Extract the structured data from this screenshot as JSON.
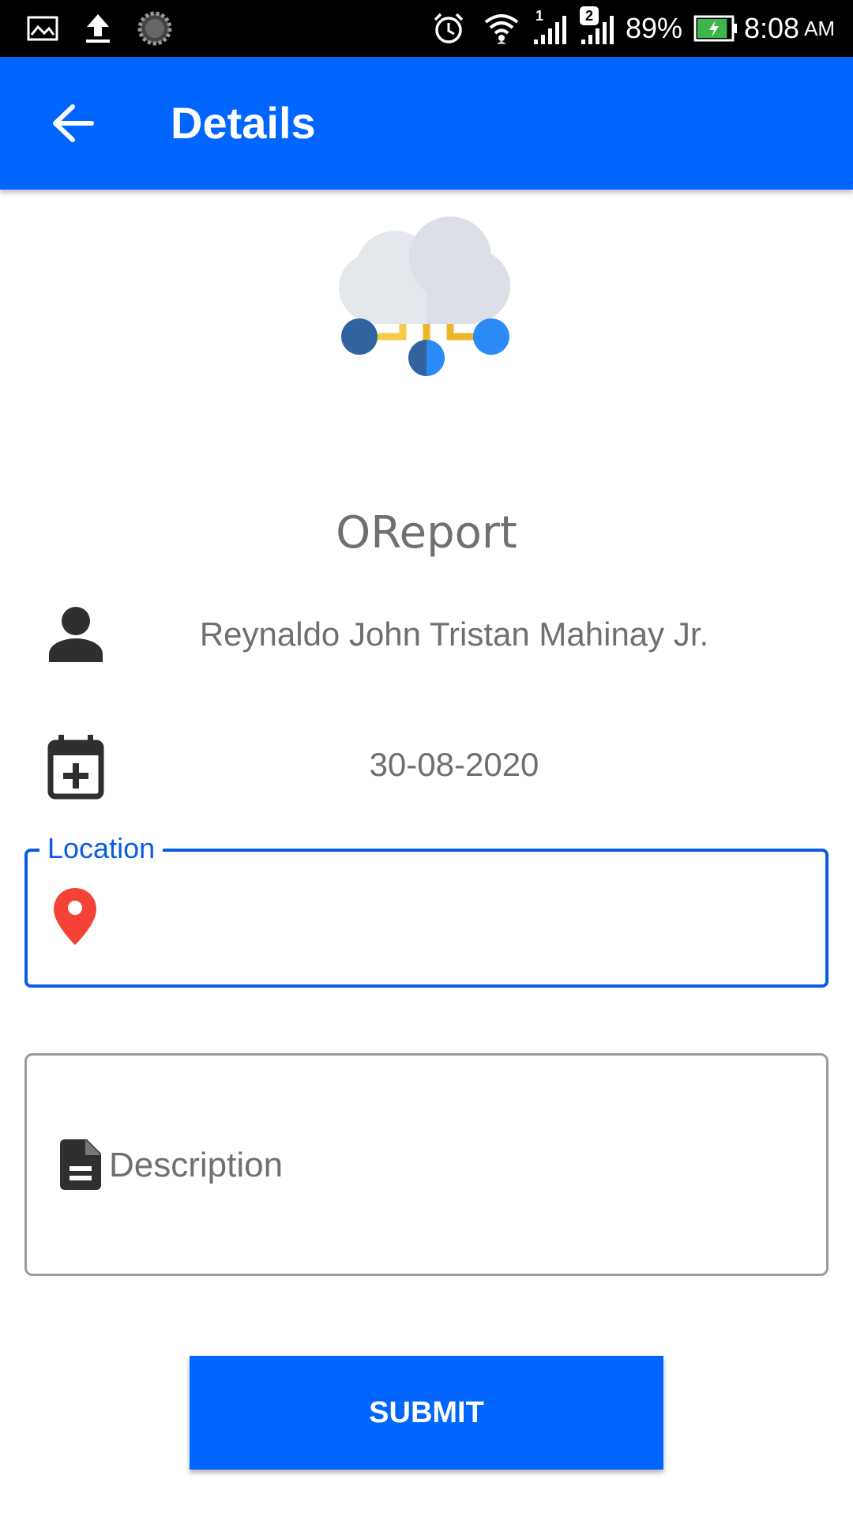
{
  "status_bar": {
    "icons": [
      "gallery-icon",
      "upload-icon",
      "loading-icon",
      "alarm-icon",
      "wifi-icon",
      "signal-icon",
      "signal-icon"
    ],
    "sim1_label": "1",
    "sim2_label": "2",
    "battery_percent": "89%",
    "battery_level": 0.89,
    "time": "8:08",
    "ampm": "AM"
  },
  "app_bar": {
    "title": "Details",
    "back_icon": "arrow-back-icon",
    "color": "#0066ff"
  },
  "logo": {
    "icon": "cloud-network-icon"
  },
  "app_name": "OReport",
  "user": {
    "icon": "person-icon",
    "name": "Reynaldo John Tristan Mahinay Jr."
  },
  "date": {
    "icon": "calendar-add-icon",
    "value": "30-08-2020"
  },
  "location": {
    "label": "Location",
    "value": "",
    "icon": "map-pin-icon",
    "accent": "#0a5ce6",
    "pin_color": "#f44336"
  },
  "description": {
    "placeholder": "Description",
    "icon": "document-icon"
  },
  "submit": {
    "label": "SUBMIT"
  }
}
